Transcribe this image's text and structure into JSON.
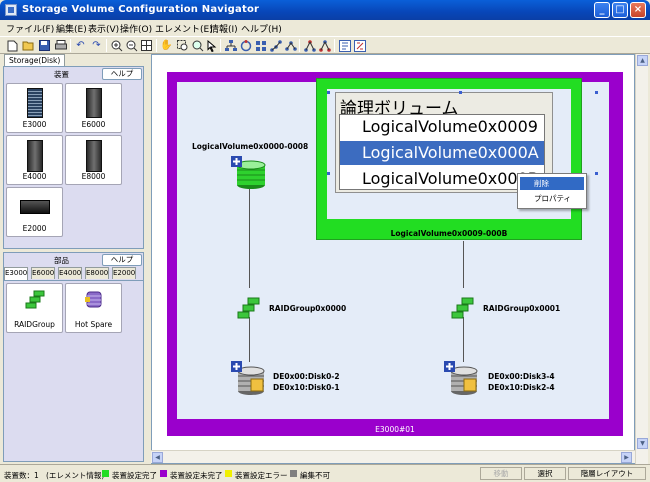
{
  "window": {
    "title": "Storage Volume Configuration Navigator"
  },
  "menu": [
    "ファイル(F)",
    "編集(E)",
    "表示(V)",
    "操作(O)",
    "エレメント(E)",
    "情報(I)",
    "ヘルプ(H)"
  ],
  "left_panel": {
    "tab": "Storage(Disk)",
    "devices": {
      "header": "装置",
      "help": "ヘルプ",
      "items": [
        "E3000",
        "E6000",
        "E4000",
        "E8000",
        "E2000"
      ]
    },
    "parts": {
      "header": "部品",
      "help": "ヘルプ",
      "tabs": [
        "E3000",
        "E6000",
        "E4000",
        "E8000",
        "E2000"
      ],
      "items": [
        "RAIDGroup",
        "Hot Spare"
      ]
    }
  },
  "canvas": {
    "enclosure_label": "E3000#01",
    "lv_group_label": "LogicalVolume0x0009-000B",
    "lv_panel": {
      "title": "論理ボリューム",
      "items": [
        "LogicalVolume0x0009",
        "LogicalVolume0x000A",
        "LogicalVolume0x000B"
      ],
      "selected_index": 1
    },
    "context_menu": [
      "削除",
      "プロパティ"
    ],
    "lv_left": "LogicalVolume0x0000-0008",
    "raid_left": "RAIDGroup0x0000",
    "raid_right": "RAIDGroup0x0001",
    "disk_left": [
      "DE0x00:Disk0-2",
      "DE0x10:Disk0-1"
    ],
    "disk_right": [
      "DE0x00:Disk3-4",
      "DE0x10:Disk2-4"
    ]
  },
  "status": {
    "count": "装置数：1",
    "info": "(エレメント情報)",
    "legend": [
      {
        "label": "装置設定完了",
        "color": "#22dd22"
      },
      {
        "label": "装置設定未完了",
        "color": "#9a00cc"
      },
      {
        "label": "装置設定エラー",
        "color": "#f0f000"
      },
      {
        "label": "編集不可",
        "color": "#808080"
      }
    ],
    "mode_disabled": "移動",
    "mode_select": "選択",
    "auto_layout": "階層レイアウト"
  }
}
